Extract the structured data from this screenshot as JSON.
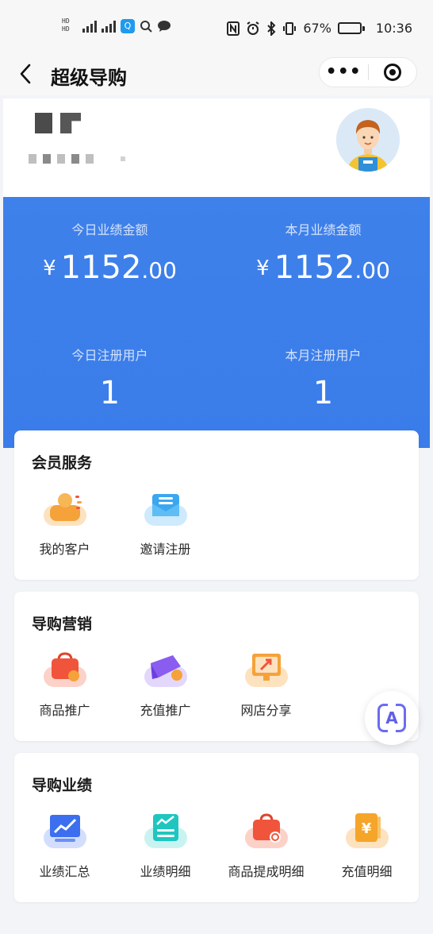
{
  "status_bar": {
    "battery_percent": "67%",
    "time": "10:36",
    "battery_level": 0.67
  },
  "nav": {
    "back_icon": "chevron-left-icon",
    "title": "超级导购",
    "more_icon": "more-dots-icon",
    "target_icon": "target-icon"
  },
  "stats": {
    "today_amount_label": "今日业绩金额",
    "today_amount_currency": "¥",
    "today_amount_int": "1152",
    "today_amount_dec": ".00",
    "month_amount_label": "本月业绩金额",
    "month_amount_currency": "¥",
    "month_amount_int": "1152",
    "month_amount_dec": ".00",
    "today_users_label": "今日注册用户",
    "today_users_value": "1",
    "month_users_label": "本月注册用户",
    "month_users_value": "1"
  },
  "member_service": {
    "title": "会员服务",
    "items": [
      {
        "label": "我的客户",
        "icon": "customer-icon",
        "color": "#f5a23a",
        "plate": "#fde2bf"
      },
      {
        "label": "邀请注册",
        "icon": "invite-icon",
        "color": "#3aa7f0",
        "plate": "#cfeafc"
      }
    ]
  },
  "marketing": {
    "title": "导购营销",
    "items": [
      {
        "label": "商品推广",
        "icon": "bag-icon",
        "color": "#f0553c",
        "plate": "#fcd2c8"
      },
      {
        "label": "充值推广",
        "icon": "recharge-icon",
        "color": "#8a5cf0",
        "plate": "#e3d7fc"
      },
      {
        "label": "网店分享",
        "icon": "store-screen-icon",
        "color": "#f5a23a",
        "plate": "#fde2bf"
      }
    ]
  },
  "performance": {
    "title": "导购业绩",
    "items": [
      {
        "label": "业绩汇总",
        "icon": "chart-summary-icon",
        "color": "#3c6ff0",
        "plate": "#d2defc"
      },
      {
        "label": "业绩明细",
        "icon": "chart-detail-icon",
        "color": "#1fc6c0",
        "plate": "#c9f3f1"
      },
      {
        "label": "商品提成明细",
        "icon": "commission-bag-icon",
        "color": "#f0553c",
        "plate": "#fcd2c8"
      },
      {
        "label": "充值明细",
        "icon": "recharge-detail-icon",
        "color": "#f5a52a",
        "plate": "#fde2bf"
      }
    ]
  },
  "float_button": {
    "icon": "translate-icon",
    "letter": "A"
  }
}
